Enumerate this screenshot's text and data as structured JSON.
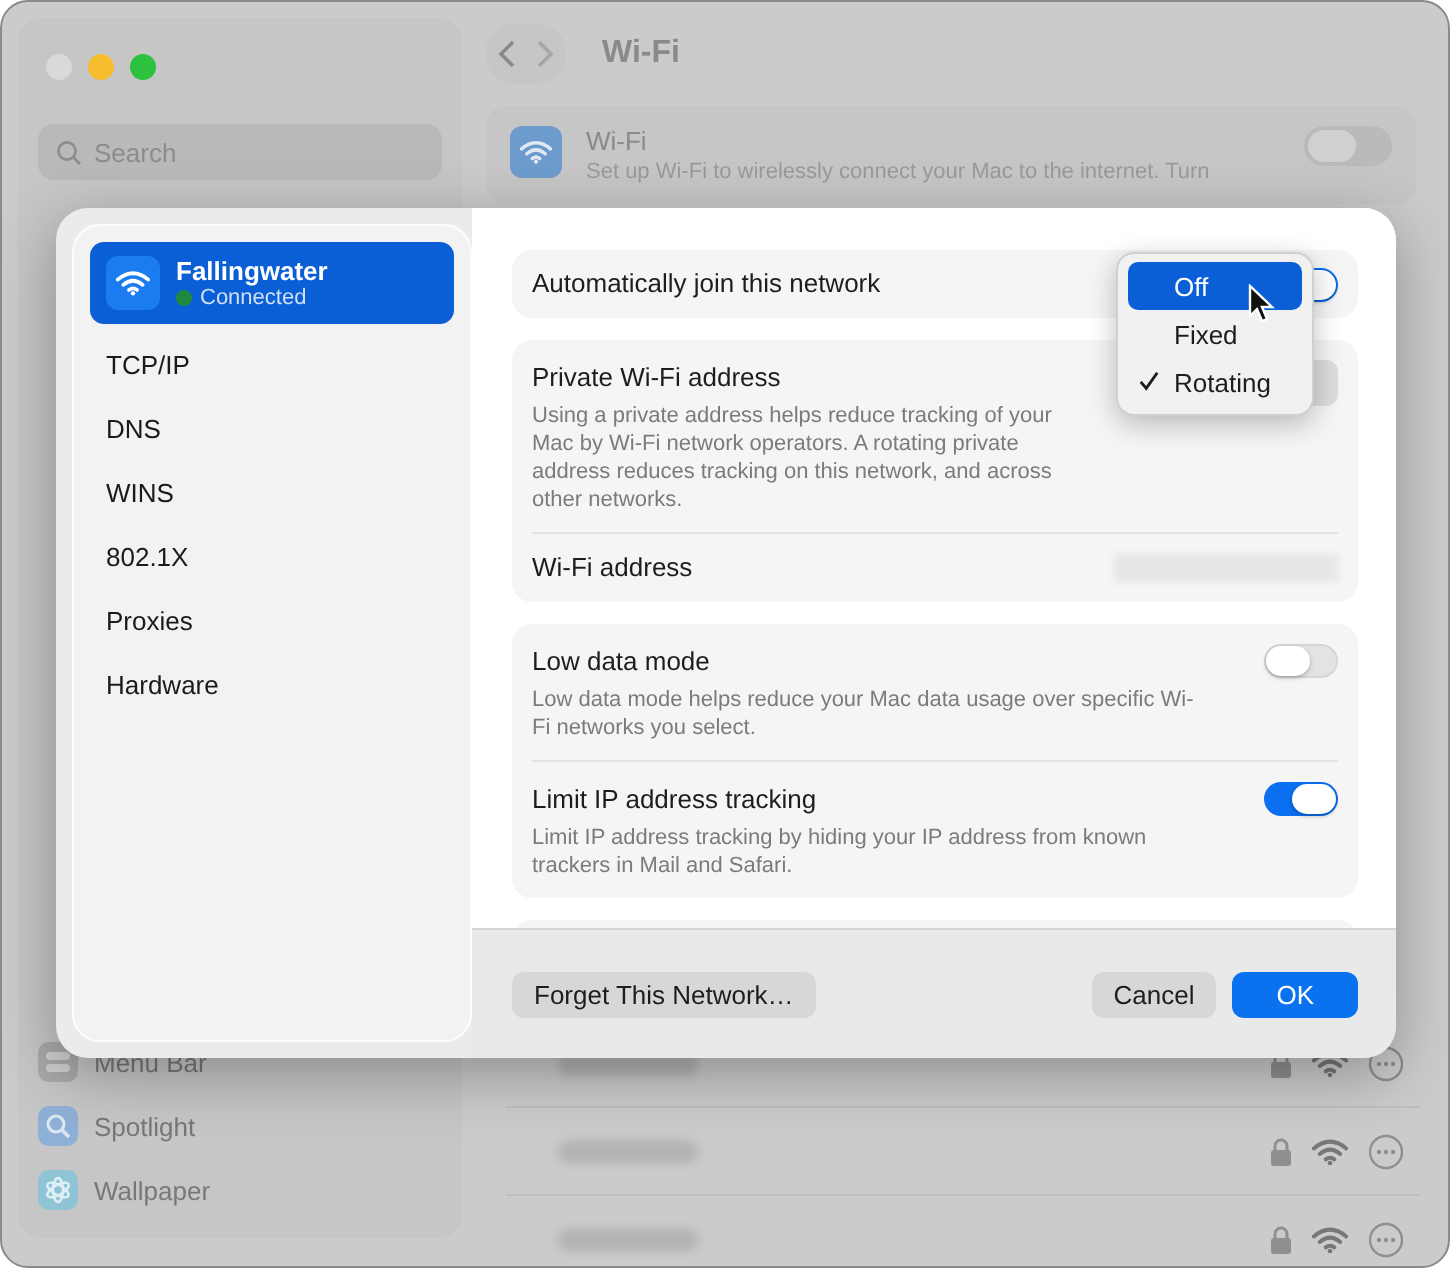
{
  "window": {
    "title": "Wi-Fi",
    "search": {
      "placeholder": "Search"
    }
  },
  "sidebar": {
    "items": [
      {
        "label": "Menu Bar",
        "kind": "toggles"
      },
      {
        "label": "Spotlight",
        "kind": "search"
      },
      {
        "label": "Wallpaper",
        "kind": "flower"
      }
    ]
  },
  "wifi_card": {
    "title": "Wi-Fi",
    "description": "Set up Wi-Fi to wirelessly connect your Mac to the internet. Turn",
    "on": false
  },
  "networks": [
    {
      "locked": true
    },
    {
      "locked": true
    },
    {
      "locked": true
    }
  ],
  "sheet": {
    "network": {
      "name": "Fallingwater",
      "status": "Connected",
      "selected": true
    },
    "tabs": [
      {
        "label": "TCP/IP",
        "selected": false
      },
      {
        "label": "DNS",
        "selected": false
      },
      {
        "label": "WINS",
        "selected": false
      },
      {
        "label": "802.1X",
        "selected": false
      },
      {
        "label": "Proxies",
        "selected": false
      },
      {
        "label": "Hardware",
        "selected": false
      }
    ],
    "auto_join": {
      "label": "Automatically join this network",
      "on": true
    },
    "private_address": {
      "label": "Private Wi-Fi address",
      "description": "Using a private address helps reduce tracking of your Mac by Wi-Fi network operators. A rotating private address reduces tracking on this network, and across other networks."
    },
    "menu": [
      {
        "label": "Off",
        "selected": true,
        "checked": false
      },
      {
        "label": "Fixed",
        "selected": false,
        "checked": false
      },
      {
        "label": "Rotating",
        "selected": false,
        "checked": true
      }
    ],
    "wifi_address": {
      "label": "Wi-Fi address"
    },
    "low_data": {
      "label": "Low data mode",
      "description": "Low data mode helps reduce your Mac data usage over specific Wi-Fi networks you select.",
      "on": false
    },
    "limit_ip": {
      "label": "Limit IP address tracking",
      "description": "Limit IP address tracking by hiding your IP address from known trackers in Mail and Safari.",
      "on": true
    },
    "buttons": {
      "forget": "Forget This Network…",
      "cancel": "Cancel",
      "ok": "OK"
    }
  }
}
